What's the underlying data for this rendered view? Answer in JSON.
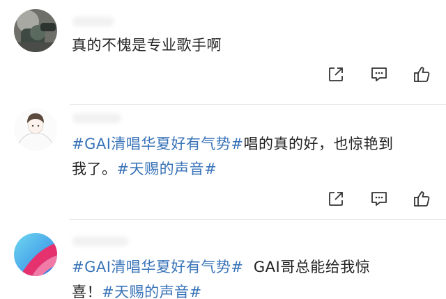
{
  "comments": [
    {
      "text": "真的不愧是专业歌手啊",
      "actions": [
        "share-icon",
        "reply-icon",
        "like-icon"
      ]
    },
    {
      "tag1": "#GAI清唱华夏好有气势#",
      "line1_rest": "唱的真的好，也惊艳到",
      "line2_plain": "我了。",
      "tag2": "#天赐的声音#",
      "actions": [
        "share-icon",
        "reply-icon",
        "like-icon"
      ]
    },
    {
      "tag1": "#GAI清唱华夏好有气势#",
      "line1_rest": "  GAI哥总能给我惊",
      "line2_plain": "喜！",
      "tag2": "#天赐的声音#"
    }
  ],
  "colors": {
    "tag": "#3873b8",
    "text": "#222222",
    "icon": "#333333"
  }
}
